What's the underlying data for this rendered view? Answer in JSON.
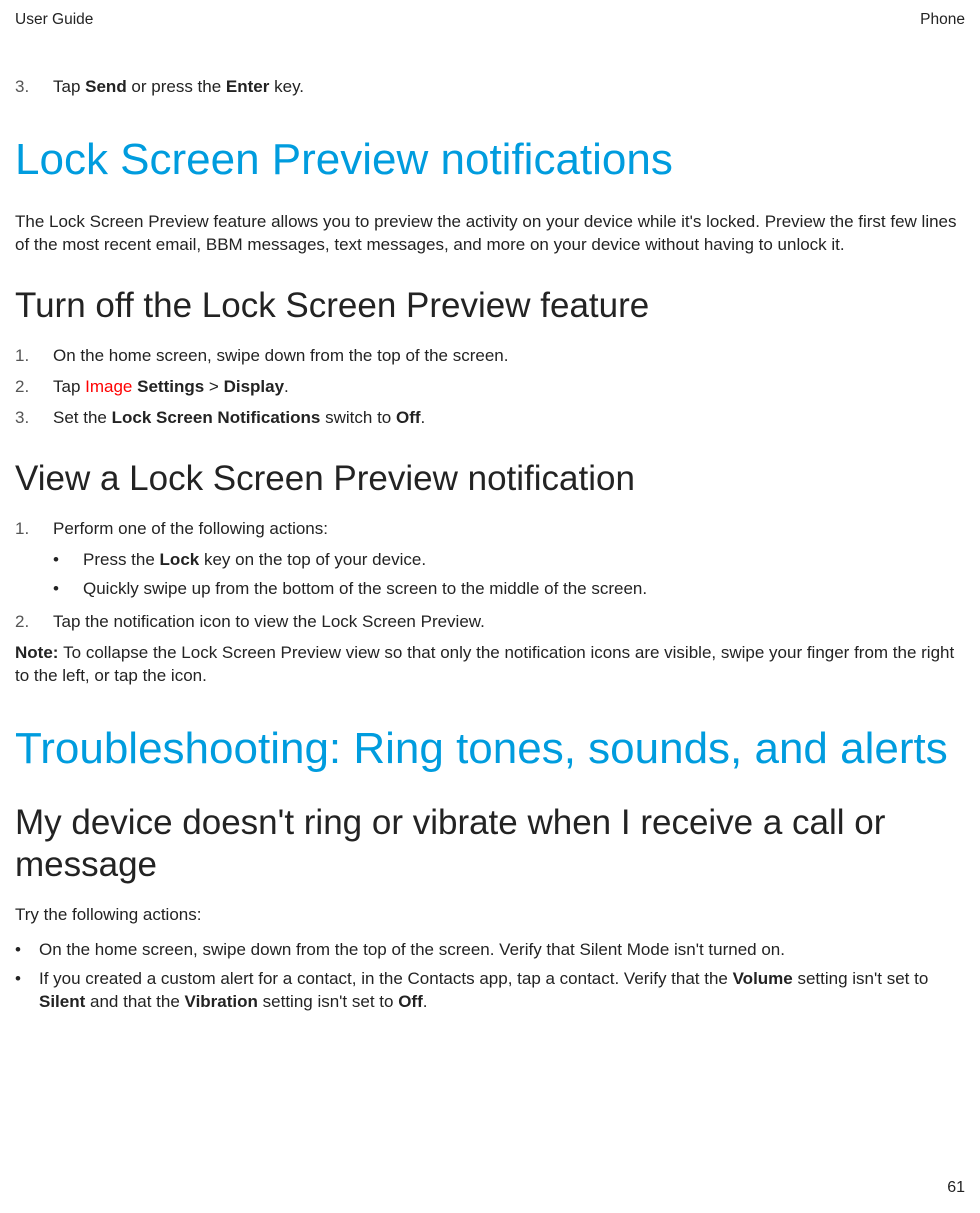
{
  "header": {
    "left": "User Guide",
    "right": "Phone"
  },
  "topItem": {
    "num": "3.",
    "pre": "Tap ",
    "b1": "Send",
    "mid": " or press the ",
    "b2": "Enter",
    "post": " key."
  },
  "h1a": "Lock Screen Preview notifications",
  "p1": "The Lock Screen Preview feature allows you to preview the activity on your device while it's locked. Preview the first few lines of the most recent email, BBM messages, text messages, and more on your device without having to unlock it.",
  "h2a": "Turn off the Lock Screen Preview feature",
  "listA": {
    "i1": {
      "num": "1.",
      "text": "On the home screen, swipe down from the top of the screen."
    },
    "i2": {
      "num": "2.",
      "pre": "Tap ",
      "img": "Image",
      "sp": " ",
      "b1": "Settings",
      "mid": " > ",
      "b2": "Display",
      "post": "."
    },
    "i3": {
      "num": "3.",
      "pre": "Set the ",
      "b1": "Lock Screen Notifications",
      "mid": " switch to ",
      "b2": "Off",
      "post": "."
    }
  },
  "h2b": "View a Lock Screen Preview notification",
  "listB": {
    "i1": {
      "num": "1.",
      "text": "Perform one of the following actions:"
    },
    "sub1": {
      "pre": "Press the ",
      "b1": "Lock",
      "post": " key on the top of your device."
    },
    "sub2": {
      "text": "Quickly swipe up from the bottom of the screen to the middle of the screen."
    },
    "i2": {
      "num": "2.",
      "text": "Tap the notification icon to view the Lock Screen Preview."
    }
  },
  "note": {
    "label": "Note: ",
    "text": "To collapse the Lock Screen Preview view so that only the notification icons are visible, swipe your finger from the right to the left, or tap the icon."
  },
  "h1b": "Troubleshooting: Ring tones, sounds, and alerts",
  "h2c": "My device doesn't ring or vibrate when I receive a call or message",
  "p2": "Try the following actions:",
  "bulletsC": {
    "b1": {
      "text": "On the home screen, swipe down from the top of the screen. Verify that Silent Mode isn't turned on."
    },
    "b2": {
      "pre": "If you created a custom alert for a contact, in the Contacts app, tap a contact. Verify that the ",
      "b1": "Volume",
      "mid1": " setting isn't set to ",
      "b2": "Silent",
      "mid2": " and that the ",
      "b3": "Vibration",
      "mid3": " setting isn't set to ",
      "b4": "Off",
      "post": "."
    }
  },
  "pageNum": "61",
  "dot": "•"
}
